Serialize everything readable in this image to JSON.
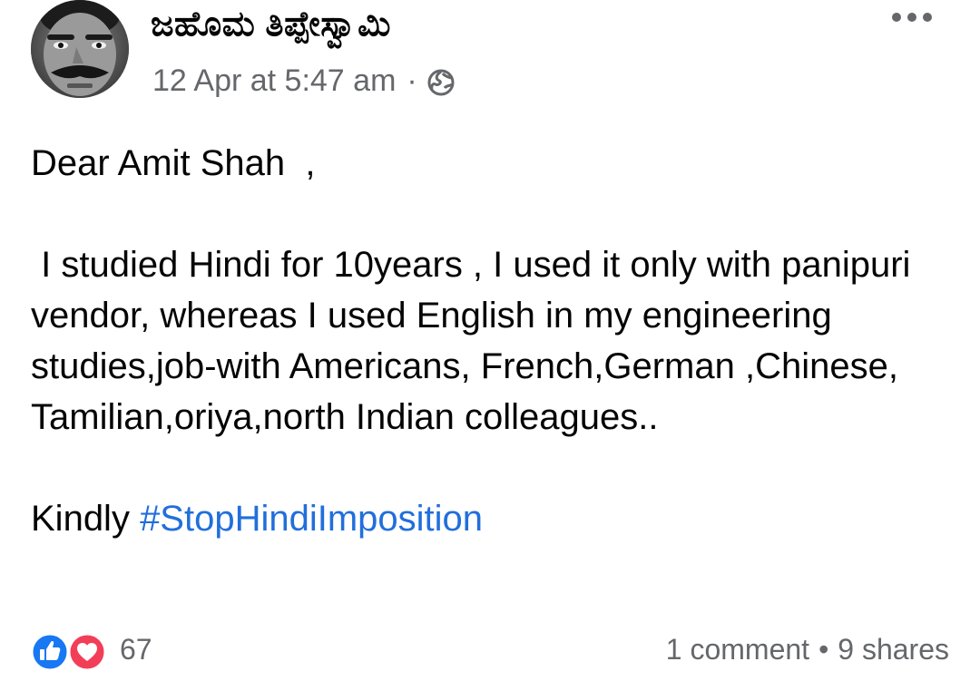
{
  "post": {
    "author": "ಜಹೊಮ ತಿಪ್ಪೇಸ್ವಾಮಿ",
    "timestamp": "12 Apr at 5:47 am",
    "separator": "·",
    "privacy_icon": "globe-icon",
    "more_icon": "more-options-icon",
    "body": {
      "greeting": "Dear Amit Shah  ,",
      "paragraph": " I studied Hindi for 10years , I used it only with panipuri vendor, whereas I used English in my engineering studies,job-with Americans, French,German ,Chinese, Tamilian,oriya,north Indian colleagues..",
      "closing_prefix": "Kindly ",
      "hashtag": "#StopHindiImposition"
    }
  },
  "footer": {
    "reaction_icons": [
      "like-icon",
      "love-icon"
    ],
    "reaction_count": "67",
    "comments": "1 comment",
    "separator": "•",
    "shares": "9 shares"
  },
  "colors": {
    "link": "#216fdb",
    "secondary_text": "#65676b",
    "like": "#1877f2",
    "love": "#f33e58"
  }
}
